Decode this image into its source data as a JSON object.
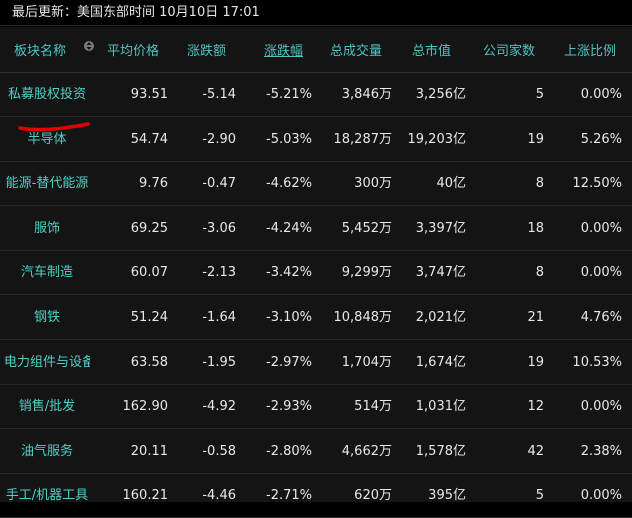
{
  "header": {
    "last_update": "最后更新：美国东部时间 10月10日 17:01"
  },
  "columns": [
    "板块名称",
    "平均价格",
    "涨跌额",
    "涨跌幅",
    "总成交量",
    "总市值",
    "公司家数",
    "上涨比例"
  ],
  "rows": [
    {
      "name": "私募股权投资",
      "price": "93.51",
      "change": "-5.14",
      "pct": "-5.21%",
      "volume": "3,846万",
      "mcap": "3,256亿",
      "count": "5",
      "up": "0.00%"
    },
    {
      "name": "半导体",
      "price": "54.74",
      "change": "-2.90",
      "pct": "-5.03%",
      "volume": "18,287万",
      "mcap": "19,203亿",
      "count": "19",
      "up": "5.26%"
    },
    {
      "name": "能源-替代能源",
      "price": "9.76",
      "change": "-0.47",
      "pct": "-4.62%",
      "volume": "300万",
      "mcap": "40亿",
      "count": "8",
      "up": "12.50%"
    },
    {
      "name": "服饰",
      "price": "69.25",
      "change": "-3.06",
      "pct": "-4.24%",
      "volume": "5,452万",
      "mcap": "3,397亿",
      "count": "18",
      "up": "0.00%"
    },
    {
      "name": "汽车制造",
      "price": "60.07",
      "change": "-2.13",
      "pct": "-3.42%",
      "volume": "9,299万",
      "mcap": "3,747亿",
      "count": "8",
      "up": "0.00%"
    },
    {
      "name": "钢铁",
      "price": "51.24",
      "change": "-1.64",
      "pct": "-3.10%",
      "volume": "10,848万",
      "mcap": "2,021亿",
      "count": "21",
      "up": "4.76%"
    },
    {
      "name": "电力组件与设备",
      "price": "63.58",
      "change": "-1.95",
      "pct": "-2.97%",
      "volume": "1,704万",
      "mcap": "1,674亿",
      "count": "19",
      "up": "10.53%"
    },
    {
      "name": "销售/批发",
      "price": "162.90",
      "change": "-4.92",
      "pct": "-2.93%",
      "volume": "514万",
      "mcap": "1,031亿",
      "count": "12",
      "up": "0.00%"
    },
    {
      "name": "油气服务",
      "price": "20.11",
      "change": "-0.58",
      "pct": "-2.80%",
      "volume": "4,662万",
      "mcap": "1,578亿",
      "count": "42",
      "up": "2.38%"
    },
    {
      "name": "手工/机器工具",
      "price": "160.21",
      "change": "-4.46",
      "pct": "-2.71%",
      "volume": "620万",
      "mcap": "395亿",
      "count": "5",
      "up": "0.00%"
    }
  ],
  "colors": {
    "background": "#141414",
    "header_text": "#4fc3c3",
    "name_text": "#4fd0c4",
    "value_text": "#e8e8e8",
    "annotation": "#e00000"
  },
  "icons": {
    "sort": "sort-updown-icon"
  }
}
